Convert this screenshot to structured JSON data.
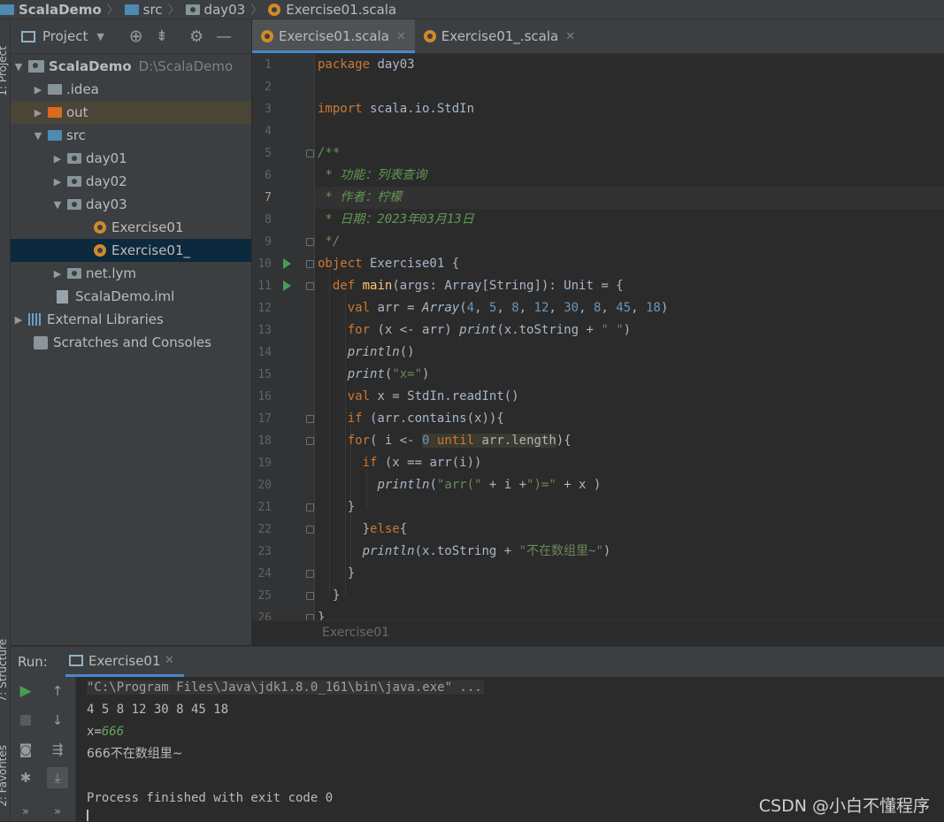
{
  "breadcrumb": {
    "project": "ScalaDemo",
    "folder1": "src",
    "folder2": "day03",
    "file": "Exercise01.scala"
  },
  "left_stripe": {
    "project_label": "1: Project",
    "structure_label": "7: Structure",
    "favorites_label": "2: Favorites"
  },
  "project_panel": {
    "title": "Project",
    "tree": [
      {
        "label": "ScalaDemo",
        "path": "D:\\ScalaDemo"
      },
      {
        "label": ".idea"
      },
      {
        "label": "out"
      },
      {
        "label": "src"
      },
      {
        "label": "day01"
      },
      {
        "label": "day02"
      },
      {
        "label": "day03"
      },
      {
        "label": "Exercise01"
      },
      {
        "label": "Exercise01_"
      },
      {
        "label": "net.lym"
      },
      {
        "label": "ScalaDemo.iml"
      },
      {
        "label": "External Libraries"
      },
      {
        "label": "Scratches and Consoles"
      }
    ]
  },
  "editor": {
    "tabs": [
      {
        "label": "Exercise01.scala",
        "active": true
      },
      {
        "label": "Exercise01_.scala",
        "active": false
      }
    ],
    "line_numbers": [
      "1",
      "2",
      "3",
      "4",
      "5",
      "6",
      "7",
      "8",
      "9",
      "10",
      "11",
      "12",
      "13",
      "14",
      "15",
      "16",
      "17",
      "18",
      "19",
      "20",
      "21",
      "22",
      "23",
      "24",
      "25",
      "26"
    ],
    "current_line": 7,
    "code_lines": [
      "package day03",
      "",
      "import scala.io.StdIn",
      "",
      "/**",
      " * 功能：列表查询",
      " * 作者：柠檬",
      " * 日期：2023年03月13日",
      " */",
      "object Exercise01 {",
      "  def main(args: Array[String]): Unit = {",
      "    val arr = Array(4, 5, 8, 12, 30, 8, 45, 18)",
      "    for (x <- arr) print(x.toString + \" \")",
      "    println()",
      "    print(\"x=\")",
      "    val x = StdIn.readInt()",
      "    if (arr.contains(x)){",
      "    for( i <- 0 until arr.length){",
      "      if (x == arr(i))",
      "        println(\"arr(\" + i +\")=\" + x )",
      "    }",
      "      }else{",
      "      println(x.toString + \"不在数组里~\")",
      "    }",
      "  }",
      "}"
    ],
    "breadcrumb_hint": "Exercise01"
  },
  "run_panel": {
    "label": "Run:",
    "tab": "Exercise01",
    "console_lines": [
      "\"C:\\Program Files\\Java\\jdk1.8.0_161\\bin\\java.exe\" ...",
      "4 5 8 12 30 8 45 18",
      "x=",
      "666",
      "666不在数组里~",
      "",
      "Process finished with exit code 0"
    ]
  },
  "watermark": "CSDN @小白不懂程序",
  "colors": {
    "keyword": "#cc7832",
    "string": "#6a8759",
    "number": "#6897bb",
    "doc_comment": "#629755",
    "function_decl": "#ffc66d",
    "selection": "#0d293e",
    "active_tab_underline": "#4a88c7"
  }
}
